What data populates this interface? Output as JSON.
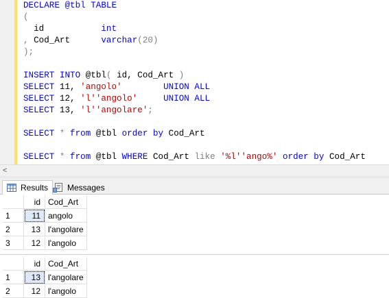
{
  "editor": {
    "lines": [
      [
        {
          "t": "DECLARE @tbl TABLE",
          "c": "kw"
        }
      ],
      [
        {
          "t": "(",
          "c": "gray"
        }
      ],
      [
        {
          "t": "  id           ",
          "c": ""
        },
        {
          "t": "int",
          "c": "kw"
        }
      ],
      [
        {
          "t": ", ",
          "c": "gray"
        },
        {
          "t": "Cod_Art      ",
          "c": ""
        },
        {
          "t": "varchar",
          "c": "kw"
        },
        {
          "t": "(20)",
          "c": "gray"
        }
      ],
      [
        {
          "t": ");",
          "c": "gray"
        }
      ],
      [
        {
          "t": "",
          "c": ""
        }
      ],
      [
        {
          "t": "INSERT INTO ",
          "c": "kw"
        },
        {
          "t": "@tbl",
          "c": ""
        },
        {
          "t": "( ",
          "c": "gray"
        },
        {
          "t": "id, Cod_Art ",
          "c": ""
        },
        {
          "t": ")",
          "c": "gray"
        }
      ],
      [
        {
          "t": "SELECT ",
          "c": "kw"
        },
        {
          "t": "11, ",
          "c": ""
        },
        {
          "t": "'angolo'",
          "c": "str"
        },
        {
          "t": "        ",
          "c": ""
        },
        {
          "t": "UNION ALL",
          "c": "kw"
        }
      ],
      [
        {
          "t": "SELECT ",
          "c": "kw"
        },
        {
          "t": "12, ",
          "c": ""
        },
        {
          "t": "'l''angolo'",
          "c": "str"
        },
        {
          "t": "     ",
          "c": ""
        },
        {
          "t": "UNION ALL",
          "c": "kw"
        }
      ],
      [
        {
          "t": "SELECT ",
          "c": "kw"
        },
        {
          "t": "13, ",
          "c": ""
        },
        {
          "t": "'l''angolare'",
          "c": "str"
        },
        {
          "t": ";",
          "c": "gray"
        }
      ],
      [
        {
          "t": "",
          "c": ""
        }
      ],
      [
        {
          "t": "SELECT ",
          "c": "kw"
        },
        {
          "t": "* ",
          "c": "gray"
        },
        {
          "t": "from ",
          "c": "kw"
        },
        {
          "t": "@tbl ",
          "c": ""
        },
        {
          "t": "order by ",
          "c": "kw"
        },
        {
          "t": "Cod_Art",
          "c": ""
        }
      ],
      [
        {
          "t": "",
          "c": ""
        }
      ],
      [
        {
          "t": "SELECT ",
          "c": "kw"
        },
        {
          "t": "* ",
          "c": "gray"
        },
        {
          "t": "from ",
          "c": "kw"
        },
        {
          "t": "@tbl ",
          "c": ""
        },
        {
          "t": "WHERE ",
          "c": "kw"
        },
        {
          "t": "Cod_Art ",
          "c": ""
        },
        {
          "t": "like ",
          "c": "gray"
        },
        {
          "t": "'%l''ango%'",
          "c": "str"
        },
        {
          "t": " order by ",
          "c": "kw"
        },
        {
          "t": "Cod_Art",
          "c": ""
        }
      ]
    ]
  },
  "tabs": [
    {
      "label": "Results",
      "icon": "grid-icon",
      "active": true
    },
    {
      "label": "Messages",
      "icon": "messages-icon",
      "active": false
    }
  ],
  "result_grids": [
    {
      "columns": [
        "id",
        "Cod_Art"
      ],
      "rows": [
        [
          "1",
          "11",
          "angolo"
        ],
        [
          "2",
          "13",
          "l'angolare"
        ],
        [
          "3",
          "12",
          "l'angolo"
        ]
      ]
    },
    {
      "columns": [
        "id",
        "Cod_Art"
      ],
      "rows": [
        [
          "1",
          "13",
          "l'angolare"
        ],
        [
          "2",
          "12",
          "l'angolo"
        ]
      ]
    }
  ]
}
